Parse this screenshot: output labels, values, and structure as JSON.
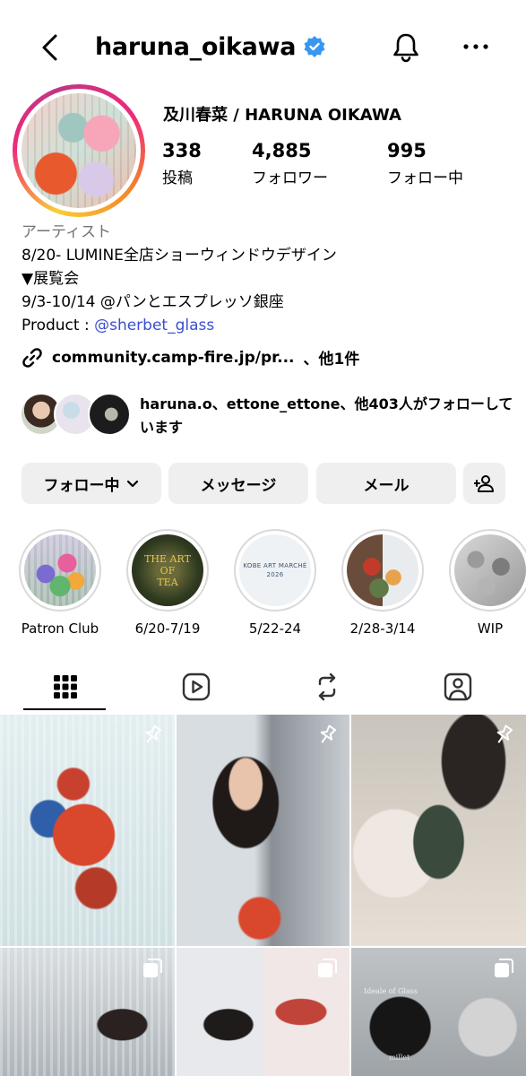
{
  "header": {
    "username": "haruna_oikawa",
    "verified": true,
    "icons": [
      "back-arrow-icon",
      "verified-badge-icon",
      "bell-icon",
      "more-icon"
    ]
  },
  "profile": {
    "display_name": "及川春菜 / HARUNA OIKAWA",
    "stats": [
      {
        "value": "338",
        "label": "投稿"
      },
      {
        "value": "4,885",
        "label": "フォロワー"
      },
      {
        "value": "995",
        "label": "フォロー中"
      }
    ]
  },
  "bio": {
    "category": "アーティスト",
    "line1": "8/20- LUMINE全店ショーウィンドウデザイン",
    "line2": "▼展覧会",
    "line3": "9/3-10/14 @パンとエスプレッソ銀座",
    "product_prefix": "Product : ",
    "product_mention": "@sherbet_glass",
    "link_text": "community.camp-fire.jp/pr...",
    "link_suffix": "、他1件"
  },
  "followed_by": {
    "names": "haruna.o、ettone_ettone、",
    "rest": "他403人がフォローしています"
  },
  "buttons": {
    "following": "フォロー中",
    "message": "メッセージ",
    "email": "メール"
  },
  "highlights": [
    {
      "label": "Patron Club"
    },
    {
      "label": "6/20-7/19",
      "art_text_1": "THE ART",
      "art_text_2": "OF",
      "art_text_3": "TEA"
    },
    {
      "label": "5/22-24",
      "art_text_1": "KOBE ART MARCHÉ",
      "art_text_2": "2026"
    },
    {
      "label": "2/28-3/14"
    },
    {
      "label": "WIP"
    }
  ],
  "tabs": [
    "grid-icon",
    "reels-icon",
    "reposts-icon",
    "tagged-icon"
  ],
  "grid_labels": {
    "cd_title": "Ideale of Glass",
    "cd_subtitle": "millet"
  },
  "colors": {
    "verified_blue": "#3897f0",
    "mention_blue": "#3b4fce",
    "button_gray": "#efefef",
    "category_gray": "#737373"
  }
}
